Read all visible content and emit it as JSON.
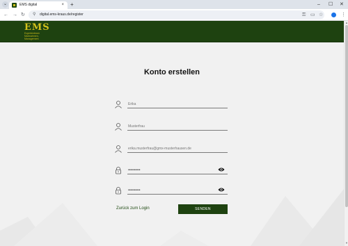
{
  "browser": {
    "tab_title": "EMS digital",
    "tab_close": "×",
    "new_tab": "+",
    "url": "digital.ems-kraus.de/register",
    "window_controls": [
      "⌄",
      "–",
      "☐",
      "✕"
    ],
    "nav": {
      "back": "←",
      "forward": "→",
      "reload": "↻"
    },
    "toolbar_icons": [
      "key-icon",
      "cast-icon",
      "star-icon",
      "menu-icon"
    ]
  },
  "header": {
    "logo_text": "EMS",
    "logo_tagline": [
      "Expertenteam",
      "Maßnahmen-",
      "Management"
    ],
    "background": "#1e4210",
    "accent": "#d4c21c"
  },
  "form": {
    "title": "Konto erstellen",
    "fields": [
      {
        "type": "person",
        "placeholder": "Erika"
      },
      {
        "type": "person",
        "placeholder": "Musterfrau"
      },
      {
        "type": "person",
        "placeholder": "erika.musterfrau@gmx-musterhausen.de"
      },
      {
        "type": "password",
        "value": "••••••••••"
      },
      {
        "type": "password",
        "value": "••••••••••"
      }
    ],
    "back_link": "Zurück zum Login",
    "submit": "SENDEN"
  }
}
